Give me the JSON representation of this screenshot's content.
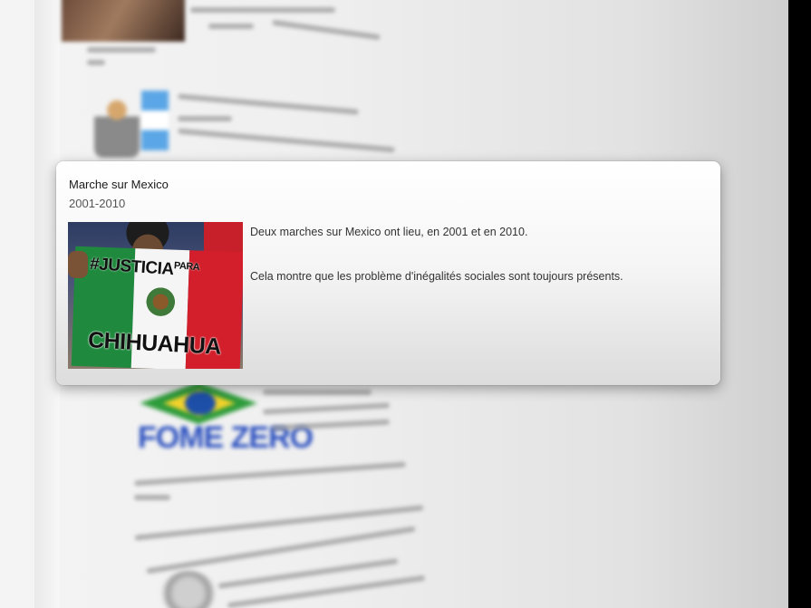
{
  "event": {
    "title": "Marche sur Mexico",
    "dates": "2001-2010",
    "paragraphs": [
      "Deux marches sur Mexico ont lieu, en 2001 et en 2010.",
      "Cela montre que les problème d'inégalités sociales sont toujours présents."
    ],
    "photo": {
      "banner_line1": "#JUSTICIA",
      "banner_line1_small": "PARA",
      "banner_line2": "CHIHUAHUA"
    }
  },
  "background": {
    "fome_zero_logo_text": "FOME ZERO"
  }
}
